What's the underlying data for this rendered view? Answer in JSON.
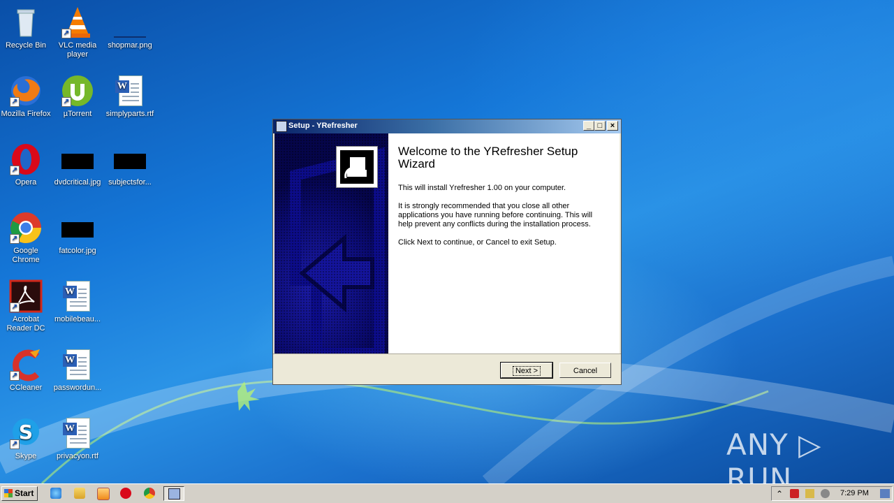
{
  "desktop": {
    "icons": [
      {
        "label": "Recycle Bin",
        "icon": "recycle-bin-icon"
      },
      {
        "label": "VLC media player",
        "icon": "vlc-icon"
      },
      {
        "label": "shopmar.png",
        "icon": "image-file-icon"
      },
      {
        "label": "Mozilla Firefox",
        "icon": "firefox-icon"
      },
      {
        "label": "µTorrent",
        "icon": "utorrent-icon"
      },
      {
        "label": "simplyparts.rtf",
        "icon": "word-document-icon"
      },
      {
        "label": "Opera",
        "icon": "opera-icon"
      },
      {
        "label": "dvdcritical.jpg",
        "icon": "image-file-icon"
      },
      {
        "label": "subjectsfor...",
        "icon": "image-file-icon"
      },
      {
        "label": "Google Chrome",
        "icon": "chrome-icon"
      },
      {
        "label": "fatcolor.jpg",
        "icon": "image-file-icon"
      },
      {
        "label": "Acrobat Reader DC",
        "icon": "acrobat-icon"
      },
      {
        "label": "mobilebeau...",
        "icon": "word-document-icon"
      },
      {
        "label": "CCleaner",
        "icon": "ccleaner-icon"
      },
      {
        "label": "passwordun...",
        "icon": "word-document-icon"
      },
      {
        "label": "Skype",
        "icon": "skype-icon"
      },
      {
        "label": "privacyon.rtf",
        "icon": "word-document-icon"
      }
    ]
  },
  "window": {
    "title": "Setup - YRefresher",
    "heading": "Welcome to the YRefresher Setup Wizard",
    "para1": "This will install Yrefresher 1.00 on your computer.",
    "para2": "It is strongly recommended that you close all other applications you have running before continuing. This will help prevent any conflicts during the installation process.",
    "para3": "Click Next to continue, or Cancel to exit Setup.",
    "next_label": "Next >",
    "cancel_label": "Cancel",
    "minimize_glyph": "_",
    "maximize_glyph": "□",
    "close_glyph": "×"
  },
  "taskbar": {
    "start_label": "Start",
    "clock": "7:29 PM",
    "tray_arrow": "⌃"
  },
  "watermark": "ANY ▷ RUN",
  "colors": {
    "title_active_start": "#0a246a",
    "side_panel": "#0a0a70"
  }
}
